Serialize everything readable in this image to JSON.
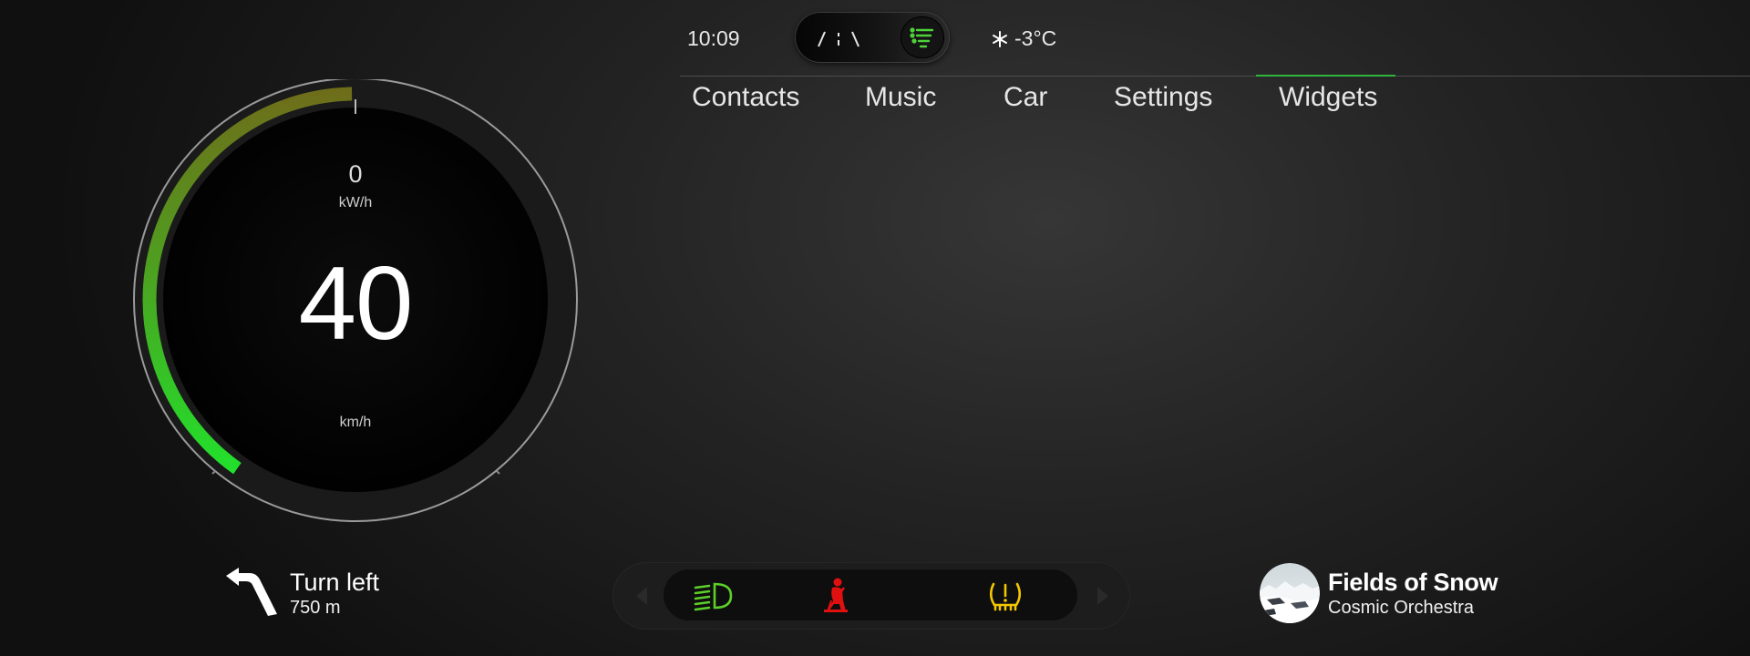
{
  "status_bar": {
    "time": "10:09",
    "temperature": "-3°C",
    "weather_icon": "snowflake-icon",
    "mode_toggle": {
      "options": [
        "road-icon",
        "list-icon"
      ],
      "selected": "list-icon"
    }
  },
  "nav": {
    "tabs": [
      {
        "label": "Contacts"
      },
      {
        "label": "Music"
      },
      {
        "label": "Car"
      },
      {
        "label": "Settings"
      },
      {
        "label": "Widgets"
      }
    ],
    "active_tab": "Widgets"
  },
  "speedometer": {
    "power_value": "0",
    "power_unit": "kW/h",
    "speed_value": "40",
    "speed_unit": "km/h",
    "arc_fill_fraction": 0.4
  },
  "navigation": {
    "instruction": "Turn left",
    "distance": "750 m",
    "icon": "turn-left-arrow-icon"
  },
  "telltales": {
    "items": [
      {
        "icon": "headlight-icon",
        "color": "#5ccf2a"
      },
      {
        "icon": "seatbelt-icon",
        "color": "#e01010"
      },
      {
        "icon": "tire-pressure-icon",
        "color": "#f2c600"
      }
    ],
    "prev_icon": "chevron-left-icon",
    "next_icon": "chevron-right-icon"
  },
  "now_playing": {
    "title": "Fields of Snow",
    "artist": "Cosmic Orchestra"
  },
  "colors": {
    "accent_green": "#2fb53b",
    "gauge_green": "#22d62c",
    "gauge_olive": "#6e6e1a"
  }
}
